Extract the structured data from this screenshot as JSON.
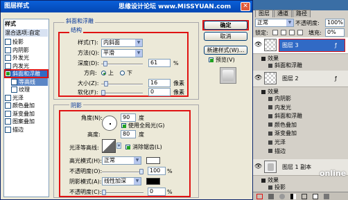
{
  "dialog": {
    "title": "图层样式",
    "watermark": "思缘设计论坛 www.MISSYUAN.com",
    "close_glyph": "✕",
    "style_list": {
      "header": "样式",
      "blend_options": "混合选项:自定",
      "items": [
        {
          "label": "投影",
          "checked": false
        },
        {
          "label": "内阴影",
          "checked": false
        },
        {
          "label": "外发光",
          "checked": false
        },
        {
          "label": "内发光",
          "checked": false
        },
        {
          "label": "斜面和浮雕",
          "checked": true
        },
        {
          "label": "等高线",
          "checked": false
        },
        {
          "label": "纹理",
          "checked": false
        },
        {
          "label": "光泽",
          "checked": false
        },
        {
          "label": "颜色叠加",
          "checked": false
        },
        {
          "label": "渐变叠加",
          "checked": false
        },
        {
          "label": "图案叠加",
          "checked": false
        },
        {
          "label": "描边",
          "checked": false
        }
      ]
    },
    "bevel": {
      "section_title": "斜面和浮雕",
      "structure_title": "结构",
      "style_label": "样式(T):",
      "style_value": "内斜面",
      "technique_label": "方法(Q):",
      "technique_value": "平滑",
      "depth_label": "深度(D):",
      "depth_value": "61",
      "depth_unit": "%",
      "depth_level": 0.061,
      "direction_label": "方向:",
      "dir_up": "上",
      "dir_down": "下",
      "size_label": "大小(Z):",
      "size_value": "16",
      "size_unit": "像素",
      "size_level": 0.065,
      "soften_label": "软化(F):",
      "soften_value": "0",
      "soften_unit": "像素",
      "soften_level": 0
    },
    "shading": {
      "section_title": "阴影",
      "angle_label": "角度(N):",
      "angle_value": "90",
      "angle_unit": "度",
      "global_light_label": "使用全局光(G)",
      "altitude_label": "高度:",
      "altitude_value": "80",
      "altitude_unit": "度",
      "contour_label": "光泽等高线:",
      "antialias_label": "消除锯齿(L)",
      "highlight_mode_label": "高光模式(H):",
      "highlight_mode_value": "正常",
      "highlight_color": "#ffffff",
      "highlight_opacity_label": "不透明度(O):",
      "highlight_opacity_value": "100",
      "highlight_opacity_unit": "%",
      "highlight_opacity_level": 1.0,
      "shadow_mode_label": "阴影模式(A):",
      "shadow_mode_value": "线性加深",
      "shadow_color": "#000000",
      "shadow_opacity_label": "不透明度(C):",
      "shadow_opacity_value": "0",
      "shadow_opacity_unit": "%",
      "shadow_opacity_level": 0
    },
    "buttons": {
      "ok": "确定",
      "cancel": "取消",
      "new_style": "新建样式(W)...",
      "preview": "预览(V)"
    }
  },
  "layers_panel": {
    "tabs": [
      "图层",
      "通道",
      "路径"
    ],
    "blend_mode": "正常",
    "opacity_label": "不透明度:",
    "opacity_value": "100%",
    "lock_label": "锁定:",
    "fill_label": "填充:",
    "fill_value": "0%",
    "layer3": {
      "name": "图层 3",
      "effects_label": "效果",
      "effects": [
        "斜面和浮雕"
      ]
    },
    "layer2": {
      "name": "图层 2",
      "effects_label": "效果",
      "effects": [
        "内阴影",
        "内发光",
        "斜面和浮雕",
        "颜色叠加",
        "渐变叠加",
        "光泽",
        "描边"
      ]
    },
    "layer1copy": {
      "name": "图层 1 副本",
      "effects_label": "效果",
      "effects": [
        "投影"
      ]
    },
    "watermark": "online"
  },
  "colors": {
    "accent_red": "#e01212",
    "title_blue": "#0a5fd8",
    "select_blue": "#316ac5"
  }
}
